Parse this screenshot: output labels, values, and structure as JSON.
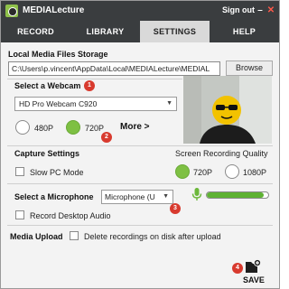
{
  "app": {
    "title": "MEDIALecture",
    "sign_out": "Sign out",
    "minimize": "–",
    "close": "✕"
  },
  "tabs": [
    {
      "label": "RECORD",
      "active": false
    },
    {
      "label": "LIBRARY",
      "active": false
    },
    {
      "label": "SETTINGS",
      "active": true
    },
    {
      "label": "HELP",
      "active": false
    }
  ],
  "storage": {
    "title": "Local Media Files Storage",
    "path": "C:\\Users\\p.vincent\\AppData\\Local\\MEDIALecture\\MEDIAL",
    "browse_label": "Browse"
  },
  "webcam": {
    "title": "Select a Webcam",
    "selected": "HD Pro Webcam C920",
    "res_480": "480P",
    "res_720": "720P",
    "selected_resolution": "720P",
    "more_label": "More >"
  },
  "capture": {
    "title": "Capture Settings",
    "quality_label": "Screen Recording Quality",
    "slow_pc_label": "Slow PC Mode",
    "res_720": "720P",
    "res_1080": "1080P",
    "selected_quality": "720P"
  },
  "microphone": {
    "title": "Select a Microphone",
    "selected": "Microphone (U",
    "record_desktop_label": "Record Desktop Audio",
    "level": 0.93
  },
  "upload": {
    "title": "Media Upload",
    "delete_label": "Delete recordings on disk after upload"
  },
  "save_label": "SAVE",
  "badges": [
    "1",
    "2",
    "3",
    "4"
  ],
  "colors": {
    "titlebar": "#3a3d3f",
    "accent_green": "#7ec043",
    "badge_red": "#d83a2e"
  }
}
